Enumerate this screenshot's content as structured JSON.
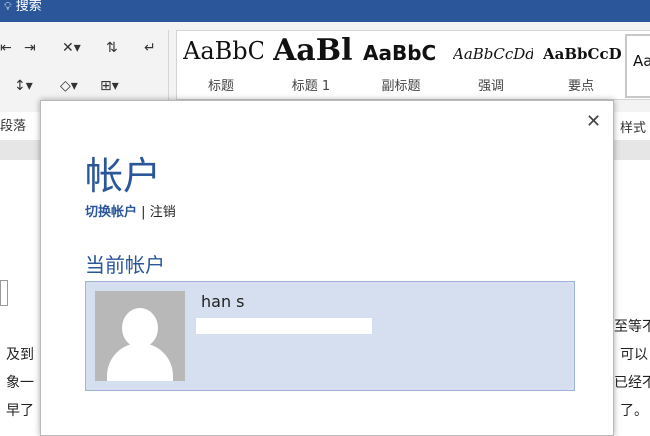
{
  "titlebar": {
    "search_label": "搜索"
  },
  "ribbon": {
    "paragraph_group_label": "段落",
    "styles_group_label": "样式",
    "styles": [
      {
        "sample": "AaBbC",
        "label": "标题"
      },
      {
        "sample": "AaBl",
        "label": "标题 1"
      },
      {
        "sample": "AaBbC",
        "label": "副标题"
      },
      {
        "sample": "AaBbCcDd",
        "label": "强调"
      },
      {
        "sample": "AaBbCcD",
        "label": "要点"
      }
    ],
    "style_more_sample": "Aa"
  },
  "document": {
    "lines_left": [
      "及到",
      "象一",
      "早了"
    ],
    "lines_right": [
      "至等不",
      "可以",
      "已经不",
      "了。"
    ]
  },
  "dialog": {
    "title": "帐户",
    "switch_account": "切换帐户",
    "separator": "|",
    "sign_out": "注销",
    "current_account_heading": "当前帐户",
    "account": {
      "name": "han s"
    }
  },
  "colors": {
    "accent": "#2b579a",
    "account_card": "#d5dff0"
  }
}
